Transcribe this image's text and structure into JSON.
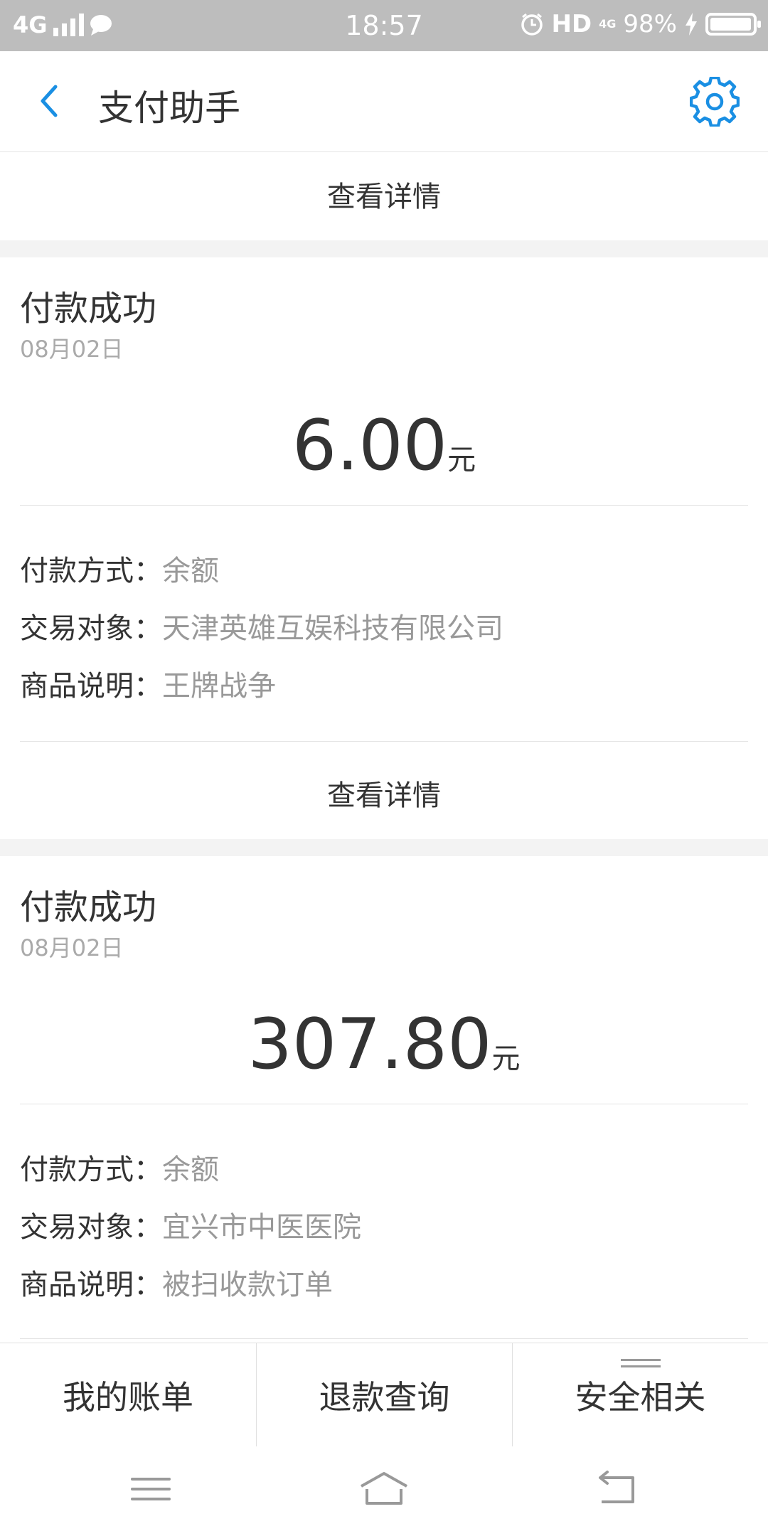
{
  "status_bar": {
    "network": "4G",
    "time": "18:57",
    "hd": "HD",
    "net_small": "4G",
    "battery": "98%",
    "battery_level": 0.98
  },
  "header": {
    "title": "支付助手"
  },
  "top_detail": "查看详情",
  "records": [
    {
      "title": "付款成功",
      "date": "08月02日",
      "amount": "6.00",
      "unit": "元",
      "rows": [
        {
          "label": "付款方式：",
          "value": "余额"
        },
        {
          "label": "交易对象：",
          "value": "天津英雄互娱科技有限公司"
        },
        {
          "label": "商品说明：",
          "value": "王牌战争"
        }
      ],
      "detail": "查看详情"
    },
    {
      "title": "付款成功",
      "date": "08月02日",
      "amount": "307.80",
      "unit": "元",
      "rows": [
        {
          "label": "付款方式：",
          "value": "余额"
        },
        {
          "label": "交易对象：",
          "value": "宜兴市中医医院"
        },
        {
          "label": "商品说明：",
          "value": "被扫收款订单"
        }
      ]
    }
  ],
  "tabs": [
    {
      "label": "我的账单"
    },
    {
      "label": "退款查询"
    },
    {
      "label": "安全相关"
    }
  ],
  "icons": {
    "back": "chevron-left-icon",
    "settings": "gear-icon",
    "menu": "menu-icon",
    "home": "home-icon",
    "return": "return-icon"
  },
  "colors": {
    "accent": "#1a8fe3",
    "status_bar": "#bdbdbd",
    "secondary_text": "#999999"
  }
}
